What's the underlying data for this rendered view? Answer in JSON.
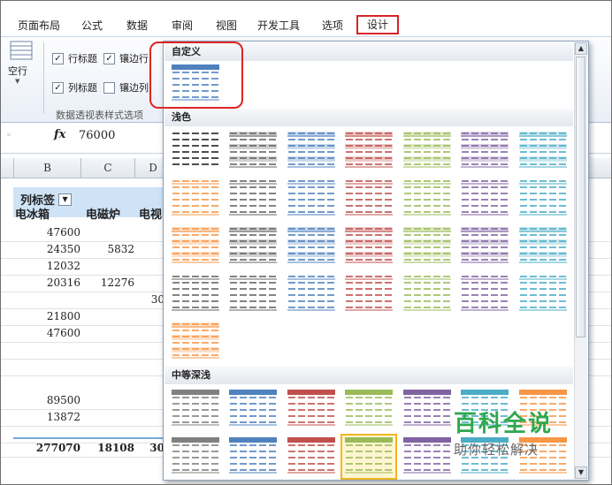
{
  "ribbon_tabs": [
    {
      "label": "页面布局"
    },
    {
      "label": "公式"
    },
    {
      "label": "数据"
    },
    {
      "label": "审阅"
    },
    {
      "label": "视图"
    },
    {
      "label": "开发工具"
    },
    {
      "label": "选项"
    },
    {
      "label": "设计"
    }
  ],
  "ribbon": {
    "blank_row_label": "空行",
    "row_headers_label": "行标题",
    "banded_rows_label": "镶边行",
    "col_headers_label": "列标题",
    "banded_cols_label": "镶边列",
    "group_label": "数据透视表样式选项"
  },
  "formula_bar": {
    "fx": "fx",
    "value": "76000"
  },
  "columns": [
    "B",
    "C",
    "D"
  ],
  "pivot": {
    "col_label_header": "列标签",
    "headers": [
      "电冰箱",
      "电磁炉",
      "电视"
    ],
    "rows": [
      [
        "47600",
        "",
        ""
      ],
      [
        "24350",
        "5832",
        ""
      ],
      [
        "12032",
        "",
        ""
      ],
      [
        "20316",
        "12276",
        ""
      ],
      [
        "",
        "",
        "30"
      ],
      [
        "21800",
        "",
        ""
      ],
      [
        "47600",
        "",
        ""
      ],
      [
        "",
        "",
        ""
      ],
      [
        "",
        "",
        ""
      ],
      [
        "89500",
        "",
        ""
      ],
      [
        "13872",
        "",
        ""
      ],
      [
        "",
        "",
        ""
      ],
      [
        "277070",
        "18108",
        "30"
      ]
    ]
  },
  "gallery": {
    "custom_label": "自定义",
    "light_label": "浅色",
    "medium_label": "中等深浅",
    "light_colors": [
      "#666666",
      "#666666",
      "#4f81bd",
      "#c0504d",
      "#9bbb59",
      "#8064a2",
      "#4bacc6",
      "#f79646"
    ],
    "medium_colors": [
      "#808080",
      "#4f81bd",
      "#c0504d",
      "#9bbb59",
      "#8064a2",
      "#4bacc6",
      "#f79646"
    ]
  },
  "watermark": {
    "line1": "百科全说",
    "line2": "助你轻松解决"
  }
}
